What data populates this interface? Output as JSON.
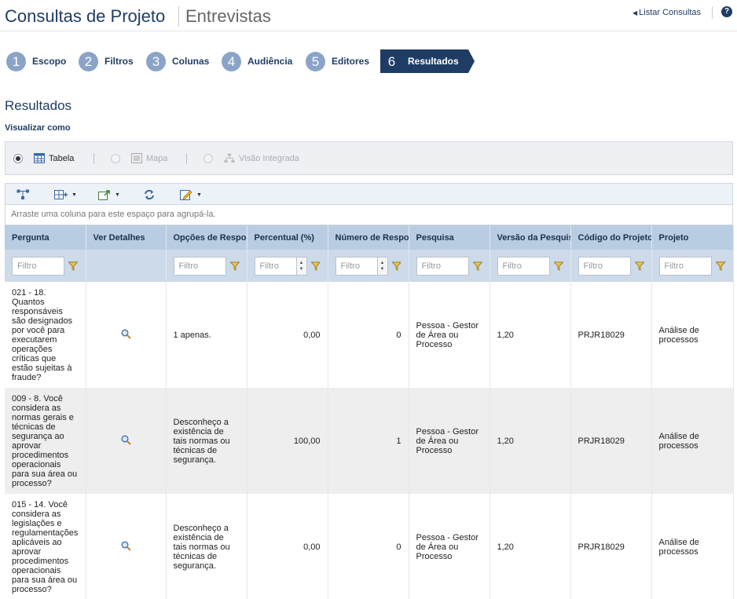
{
  "header": {
    "title": "Consultas de Projeto",
    "subtitle": "Entrevistas",
    "list_link": "Listar Consultas",
    "help": "?"
  },
  "steps": [
    {
      "num": "1",
      "label": "Escopo"
    },
    {
      "num": "2",
      "label": "Filtros"
    },
    {
      "num": "3",
      "label": "Colunas"
    },
    {
      "num": "4",
      "label": "Audiência"
    },
    {
      "num": "5",
      "label": "Editores"
    },
    {
      "num": "6",
      "label": "Resultados"
    }
  ],
  "active_step": 6,
  "section": {
    "title": "Resultados",
    "view_as": "Visualizar como"
  },
  "view_options": {
    "table": "Tabela",
    "map": "Mapa",
    "integrated": "Visão Integrada"
  },
  "grid": {
    "group_hint": "Arraste uma coluna para este espaço para agrupá-la.",
    "filter_placeholder": "Filtro",
    "columns": [
      "Pergunta",
      "Ver Detalhes",
      "Opções de Respo",
      "Percentual (%)",
      "Número de Respo",
      "Pesquisa",
      "Versão da Pesquis",
      "Código do Projeto",
      "Projeto"
    ],
    "rows": [
      {
        "pergunta": "021 - 18. Quantos responsáveis são designados por você para executarem operações críticas que estão sujeitas à fraude?",
        "opcoes": "1 apenas.",
        "percentual": "0,00",
        "numero": "0",
        "pesquisa": "Pessoa - Gestor de Área ou Processo",
        "versao": "1,20",
        "codigo": "PRJR18029",
        "projeto": "Análise de processos"
      },
      {
        "pergunta": "009 - 8. Você considera as normas gerais e técnicas de segurança ao aprovar procedimentos operacionais para sua área ou processo?",
        "opcoes": "Desconheço a existência de tais normas ou técnicas de segurança.",
        "percentual": "100,00",
        "numero": "1",
        "pesquisa": "Pessoa - Gestor de Área ou Processo",
        "versao": "1,20",
        "codigo": "PRJR18029",
        "projeto": "Análise de processos"
      },
      {
        "pergunta": "015 - 14. Você considera as legislações e regulamentações aplicáveis ao aprovar procedimentos operacionais para sua área ou processo?",
        "opcoes": "Desconheço a existência de tais normas ou técnicas de segurança.",
        "percentual": "0,00",
        "numero": "0",
        "pesquisa": "Pessoa - Gestor de Área ou Processo",
        "versao": "1,20",
        "codigo": "PRJR18029",
        "projeto": "Análise de processos"
      }
    ]
  },
  "colors": {
    "brand": "#1f3d64",
    "step_circle": "#8aa4c8",
    "header_row": "#b9cde2",
    "filter_row": "#ccdaea",
    "alt_row": "#eeeeee"
  }
}
